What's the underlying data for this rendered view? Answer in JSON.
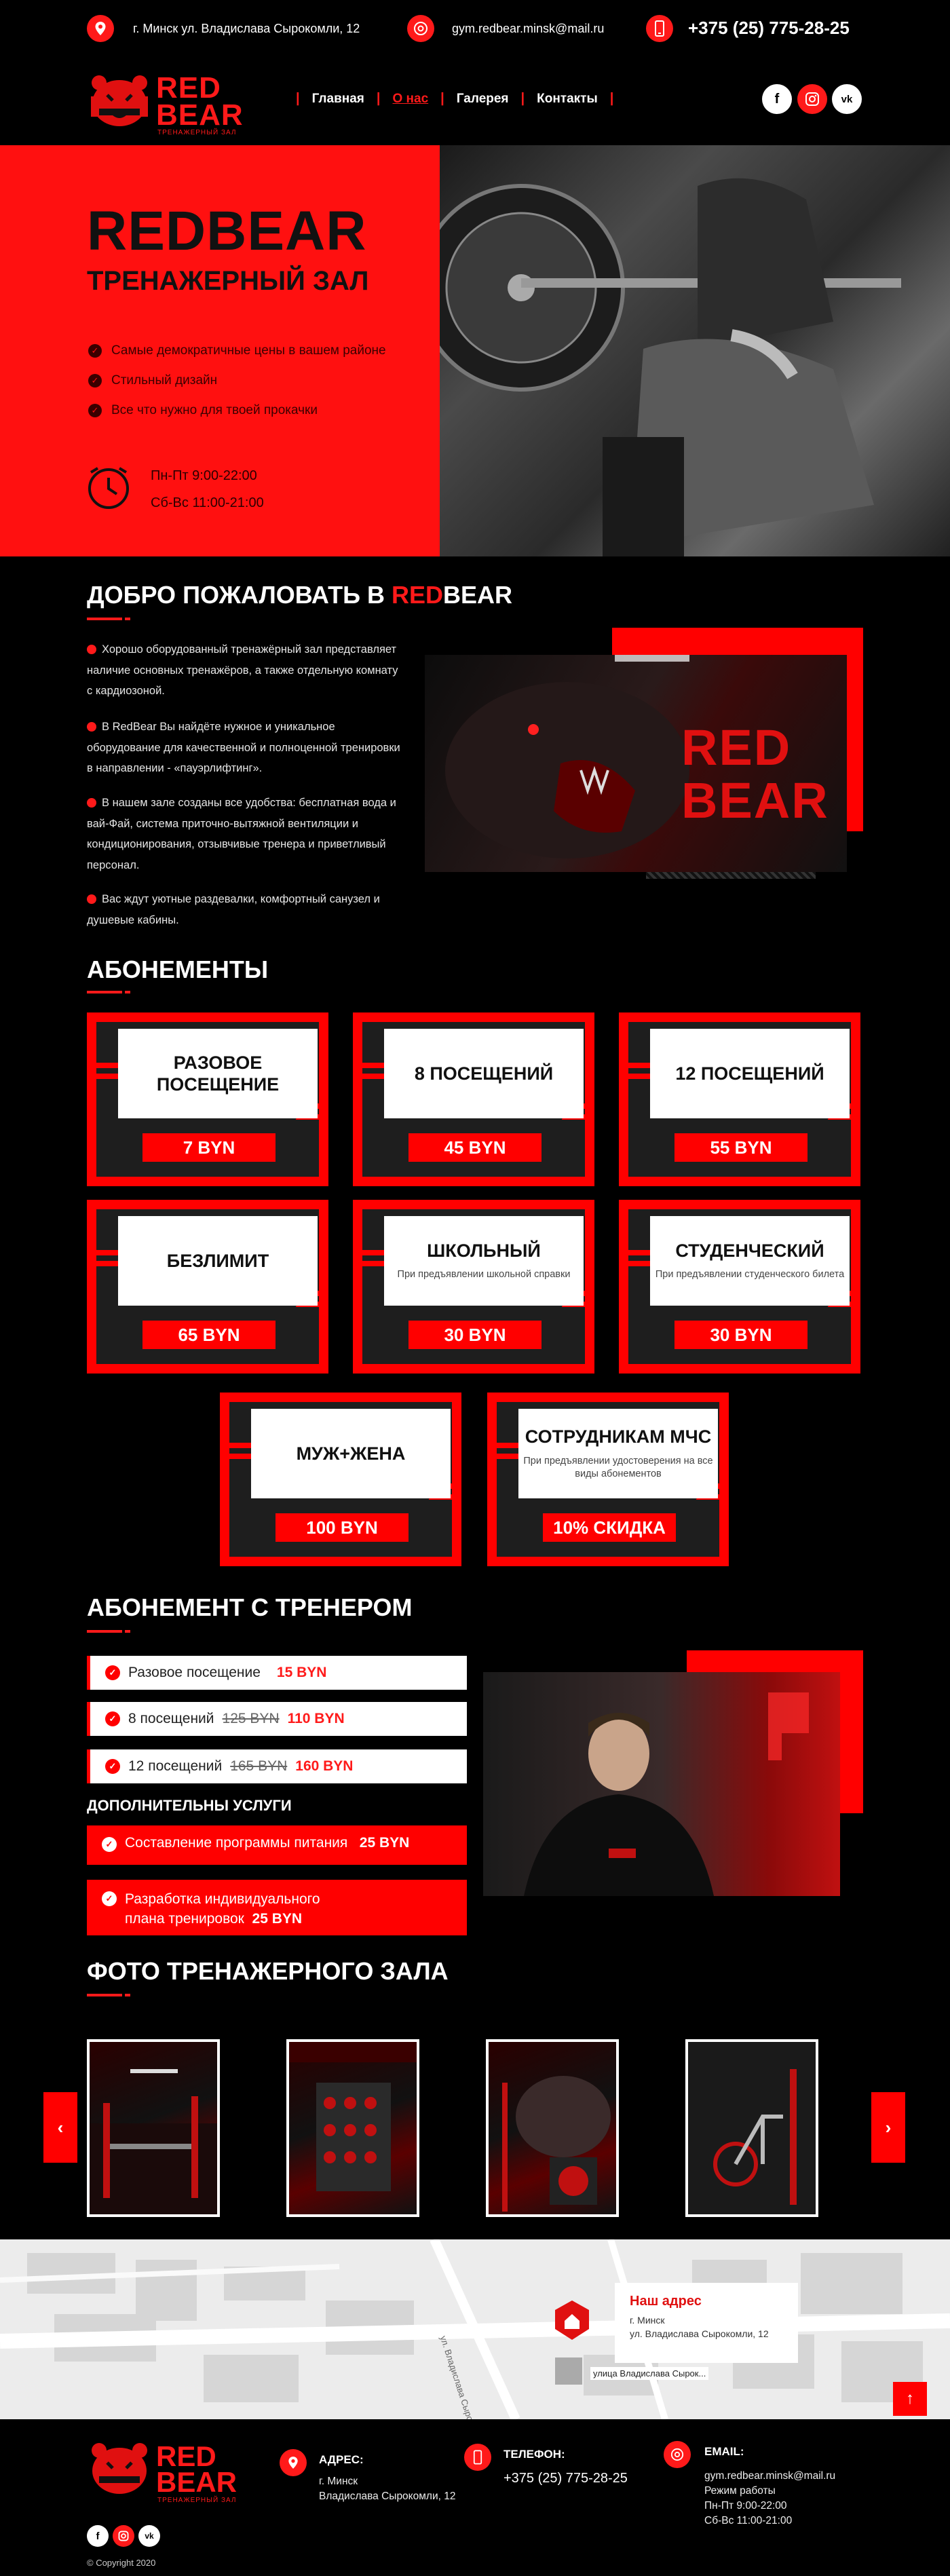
{
  "topbar": {
    "address": "г. Минск ул. Владислава Сырокомли, 12",
    "email": "gym.redbear.minsk@mail.ru",
    "phone": "+375 (25) 775-28-25"
  },
  "brand": {
    "name_red": "RED",
    "name_bear": "BEAR",
    "tagline": "ТРЕНАЖЕРНЫЙ ЗАЛ"
  },
  "nav": {
    "items": [
      "Главная",
      "О нас",
      "Галерея",
      "Контакты"
    ],
    "active": "О нас",
    "sep": "|"
  },
  "social": [
    "f",
    "ig",
    "vk"
  ],
  "colors": {
    "accent": "#ff0000",
    "background": "#000000",
    "panel": "#1e1e1e"
  },
  "hero": {
    "title": "REDBEAR",
    "subtitle": "ТРЕНАЖЕРНЫЙ ЗАЛ",
    "features": [
      "Самые демократичные цены в вашем районе",
      "Стильный дизайн",
      "Все что нужно для твоей прокачки"
    ],
    "hours": [
      "Пн-Пт 9:00-22:00",
      "Сб-Вс 11:00-21:00"
    ]
  },
  "welcome": {
    "title_prefix": "ДОБРО ПОЖАЛОВАТЬ В ",
    "title_red": "RED",
    "title_suffix": "BEAR",
    "paragraphs": [
      "Хорошо оборудованный тренажёрный зал представляет наличие основных тренажёров, а также отдельную комнату с кардиозоной.",
      "В RedBear Вы найдёте нужное и уникальное оборудование для качественной и полноценной тренировки в направлении - «пауэрлифтинг».",
      "В нашем зале созданы все удобства: бесплатная вода и вай-Фай, система приточно-вытяжной вентиляции и кондиционирования, отзывчивые тренера и приветливый персонал.",
      "Вас ждут уютные раздевалки, комфортный санузел и душевые кабины."
    ],
    "mural_red": "RED",
    "mural_bear": "BEAR"
  },
  "subscriptions": {
    "title": "АБОНЕМЕНТЫ",
    "cards": [
      {
        "title": "РАЗОВОЕ ПОСЕЩЕНИЕ",
        "sub": "",
        "price": "7 BYN"
      },
      {
        "title": "8 ПОСЕЩЕНИЙ",
        "sub": "",
        "price": "45 BYN"
      },
      {
        "title": "12 ПОСЕЩЕНИЙ",
        "sub": "",
        "price": "55 BYN"
      },
      {
        "title": "БЕЗЛИМИТ",
        "sub": "",
        "price": "65 BYN"
      },
      {
        "title": "ШКОЛЬНЫЙ",
        "sub": "При предъявлении школьной справки",
        "price": "30 BYN"
      },
      {
        "title": "СТУДЕНЧЕСКИЙ",
        "sub": "При предъявлении студенческого билета",
        "price": "30 BYN"
      },
      {
        "title": "МУЖ+ЖЕНА",
        "sub": "",
        "price": "100 BYN"
      },
      {
        "title": "СОТРУДНИКАМ МЧС",
        "sub": "При предъявлении удостоверения на все виды абонементов",
        "price": "10% СКИДКА"
      }
    ]
  },
  "trainer": {
    "title": "АБОНЕМЕНТ С ТРЕНЕРОМ",
    "rows": [
      {
        "label": "Разовое посещение",
        "old": "",
        "price": "15 BYN"
      },
      {
        "label": "8 посещений",
        "old": "125 BYN",
        "price": "110 BYN"
      },
      {
        "label": "12 посещений",
        "old": "165 BYN",
        "price": "160 BYN"
      }
    ],
    "extra_title": "ДОПОЛНИТЕЛЬНЫ УСЛУГИ",
    "services": [
      {
        "label": "Составление программы питания",
        "price": "25 BYN"
      },
      {
        "label": "Разработка индивидуального плана тренировок",
        "price": "25 BYN"
      }
    ]
  },
  "gallery": {
    "title": "ФОТО ТРЕНАЖЕРНОГО ЗАЛА",
    "prev": "‹",
    "next": "›"
  },
  "map": {
    "card_title": "Наш адрес",
    "card_city": "г. Минск",
    "card_street": "ул. Владислава Сырокомли, 12",
    "pin_label": "улица Владислава Сырок...",
    "street_label": "ул. Владислава Сырокомли"
  },
  "footer": {
    "address_label": "АДРЕС:",
    "address_lines": [
      "г. Минск",
      "Владислава Сырокомли, 12"
    ],
    "phone_label": "ТЕЛЕФОН:",
    "phone": "+375 (25) 775-28-25",
    "email_label": "EMAIL:",
    "email": "gym.redbear.minsk@mail.ru",
    "hours_label": "Режим работы",
    "hours": [
      "Пн-Пт 9:00-22:00",
      "Сб-Вс 11:00-21:00"
    ],
    "copyright": "© Copyright 2020"
  }
}
